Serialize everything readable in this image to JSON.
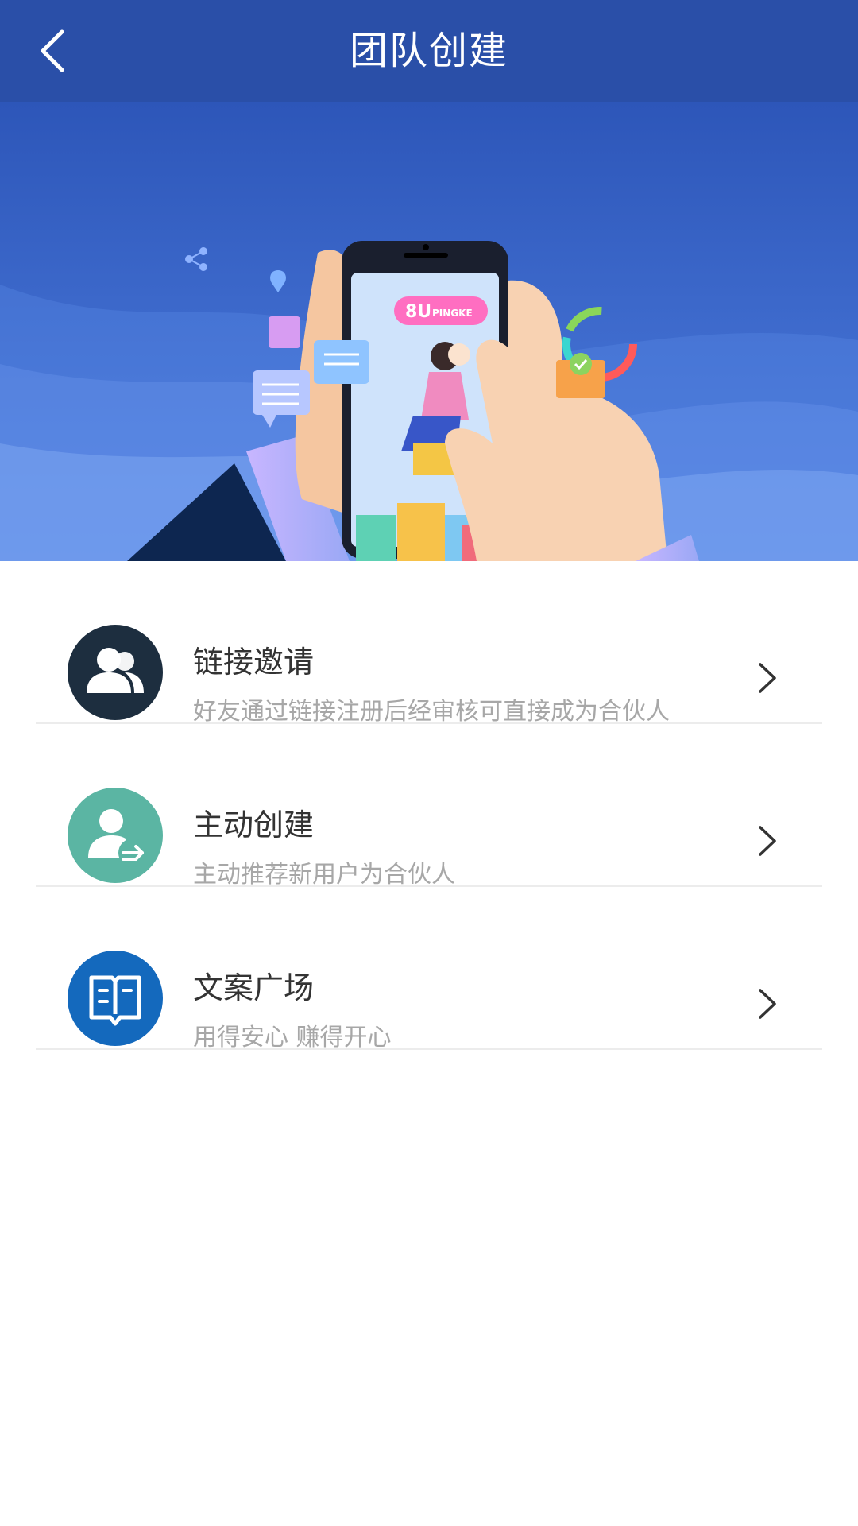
{
  "header": {
    "title": "团队创建",
    "back_icon": "chevron-left-icon"
  },
  "banner": {
    "brand_text": "8U",
    "brand_sub": "PINGKE"
  },
  "items": [
    {
      "title": "链接邀请",
      "subtitle": "好友通过链接注册后经审核可直接成为合伙人",
      "icon": "users-icon",
      "color": "#1d2e3f"
    },
    {
      "title": "主动创建",
      "subtitle": "主动推荐新用户为合伙人",
      "icon": "user-transfer-icon",
      "color": "#5bb5a3"
    },
    {
      "title": "文案广场",
      "subtitle": "用得安心 赚得开心",
      "icon": "book-icon",
      "color": "#1469bd"
    }
  ],
  "colors": {
    "header_bg": "#2a4fa8",
    "banner_bg": "#3d63c9"
  }
}
